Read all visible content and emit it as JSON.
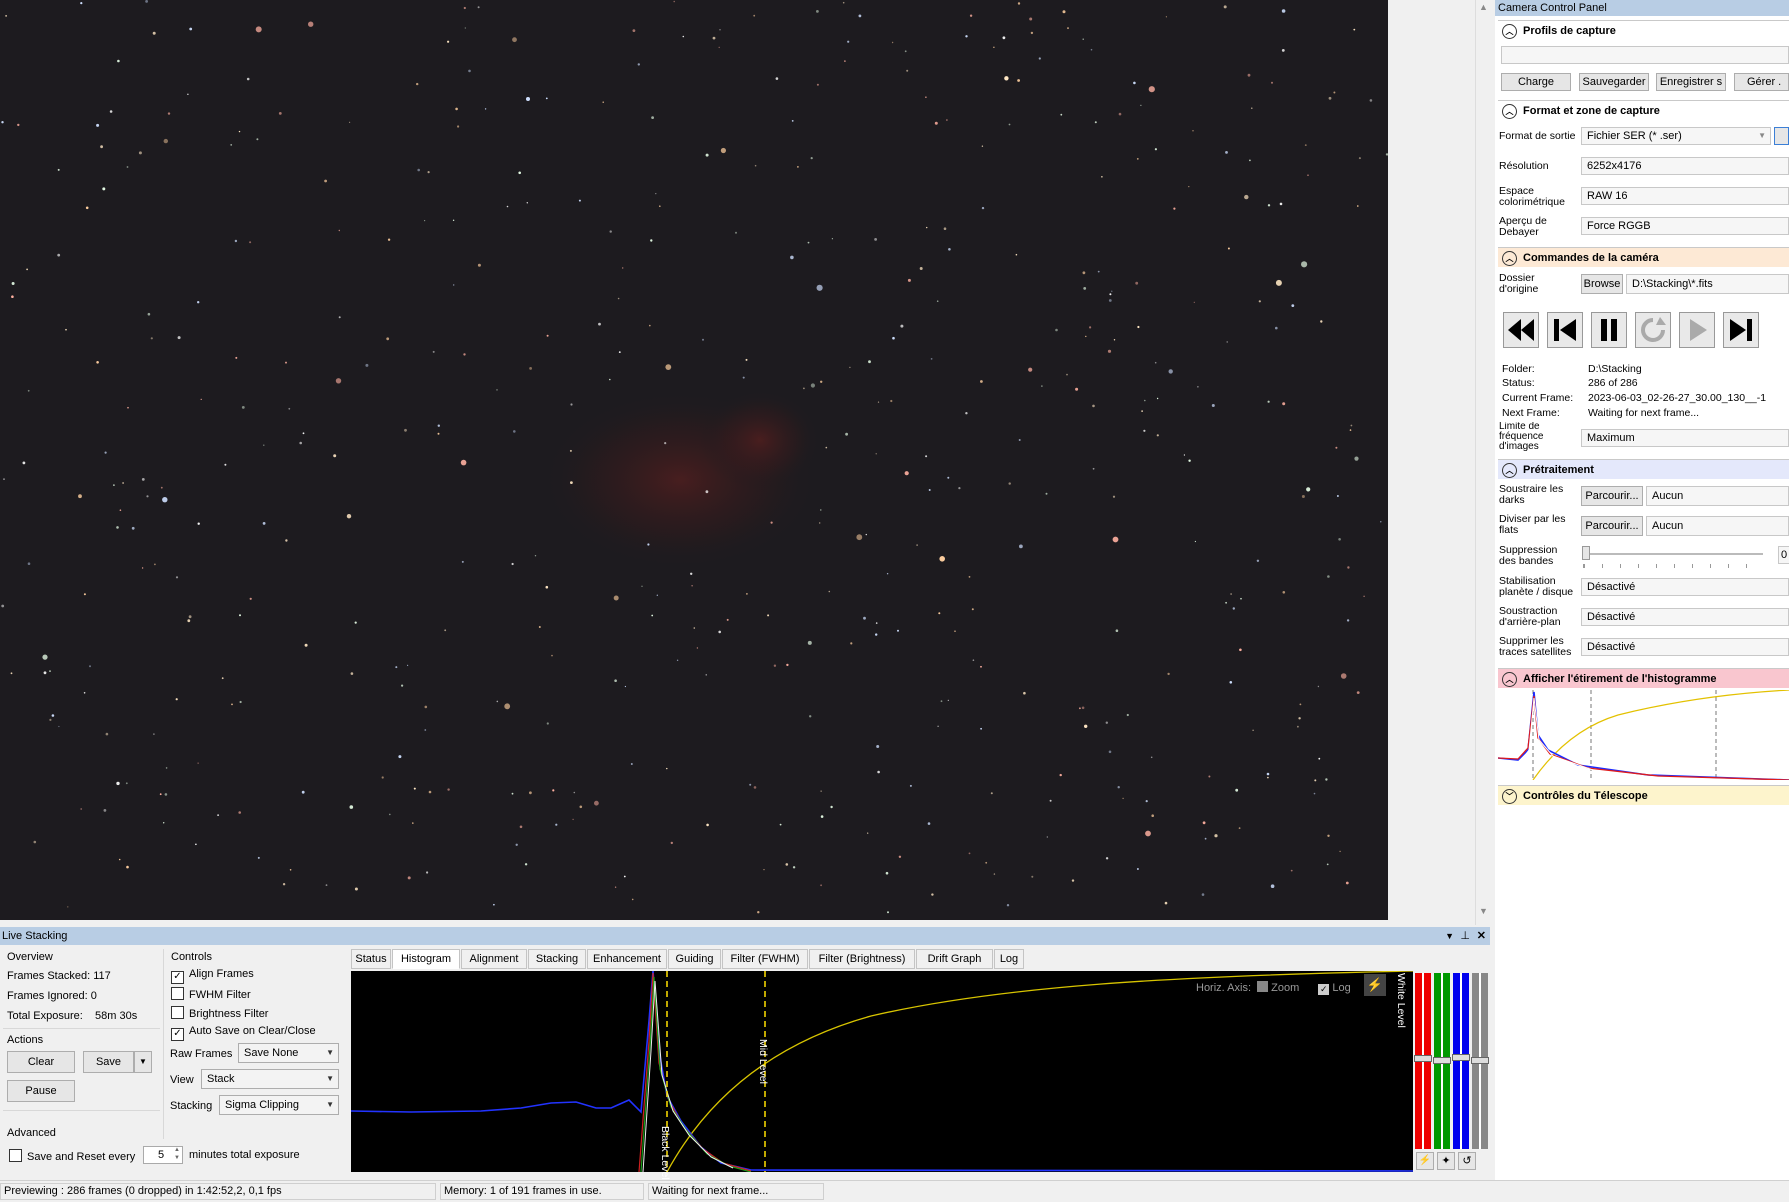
{
  "camera_panel": {
    "title": "Camera Control Panel",
    "profils": {
      "header": "Profils de capture",
      "buttons": [
        "Charge",
        "Sauvegarder",
        "Enregistrer s",
        "Gérer ."
      ]
    },
    "format": {
      "header": "Format et zone de capture",
      "rows": [
        {
          "label": "Format de sortie",
          "value": "Fichier SER (* .ser)"
        },
        {
          "label": "Résolution",
          "value": "6252x4176"
        },
        {
          "label": "Espace colorimétrique",
          "value": "RAW 16"
        },
        {
          "label": "Aperçu de Debayer",
          "value": "Force RGGB"
        }
      ]
    },
    "commandes": {
      "header": "Commandes de la caméra",
      "dossier_label": "Dossier d'origine",
      "browse_label": "Browse",
      "dossier_value": "D:\\Stacking\\*.fits",
      "media_icons": [
        "rewind-icon",
        "skip-back-icon",
        "pause-icon",
        "refresh-icon",
        "play-icon",
        "skip-end-icon"
      ],
      "info": [
        {
          "key": "Folder:",
          "value": "D:\\Stacking"
        },
        {
          "key": "Status:",
          "value": "286 of 286"
        },
        {
          "key": "Current Frame:",
          "value": "2023-06-03_02-26-27_30.00_130__-1"
        },
        {
          "key": "Next Frame:",
          "value": "Waiting for next frame..."
        }
      ],
      "limite_label": "Limite de fréquence d'images",
      "limite_value": "Maximum"
    },
    "pretraitement": {
      "header": "Prétraitement",
      "browse_label": "Parcourir...",
      "darks_label": "Soustraire les darks",
      "darks_value": "Aucun",
      "flats_label": "Diviser par les flats",
      "flats_value": "Aucun",
      "bandes_label": "Suppression des bandes",
      "bandes_value": "0",
      "rows": [
        {
          "label": "Stabilisation planète / disque",
          "value": "Désactivé"
        },
        {
          "label": "Soustraction d'arrière-plan",
          "value": "Désactivé"
        },
        {
          "label": "Supprimer les traces satellites",
          "value": "Désactivé"
        }
      ]
    },
    "histogramme": {
      "header": "Afficher l'étirement de l'histogramme"
    },
    "telescope": {
      "header": "Contrôles du Télescope"
    }
  },
  "live_stacking": {
    "title": "Live Stacking",
    "overview": {
      "header": "Overview",
      "frames_stacked": "Frames Stacked: 117",
      "frames_ignored": "Frames Ignored: 0",
      "total_exposure_label": "Total Exposure:",
      "total_exposure_value": "58m 30s"
    },
    "actions": {
      "header": "Actions",
      "clear": "Clear",
      "save": "Save",
      "pause": "Pause"
    },
    "advanced": {
      "header": "Advanced",
      "save_reset_label": "Save and Reset every",
      "minutes_value": "5",
      "minutes_suffix": "minutes total exposure"
    },
    "controls": {
      "header": "Controls",
      "checkboxes": [
        {
          "label": "Align Frames",
          "checked": true
        },
        {
          "label": "FWHM Filter",
          "checked": false
        },
        {
          "label": "Brightness Filter",
          "checked": false
        },
        {
          "label": "Auto Save on Clear/Close",
          "checked": true
        }
      ],
      "raw_frames_label": "Raw Frames",
      "raw_frames_value": "Save None",
      "view_label": "View",
      "view_value": "Stack",
      "stacking_label": "Stacking",
      "stacking_value": "Sigma Clipping"
    },
    "tabs": [
      "Status",
      "Histogram",
      "Alignment",
      "Stacking",
      "Enhancement",
      "Guiding",
      "Filter (FWHM)",
      "Filter (Brightness)",
      "Drift Graph",
      "Log"
    ],
    "active_tab": "Histogram",
    "histogram": {
      "horiz_axis_label": "Horiz. Axis:",
      "zoom_label": "Zoom",
      "zoom_checked": false,
      "log_label": "Log",
      "log_checked": true,
      "black_level_label": "Black Level",
      "mid_level_label": "Mid Level",
      "white_level_label": "White Level"
    }
  },
  "status_bar": {
    "preview": "Previewing : 286 frames (0 dropped) in 1:42:52,2, 0,1 fps",
    "memory": "Memory: 1 of 191 frames in use.",
    "waiting": "Waiting for next frame..."
  },
  "colors": {
    "panel_title_bg": "#b8cde4",
    "commandes_bg": "#fde9d5",
    "pretraitement_bg": "#e4e8fb",
    "histogramme_bg": "#f9c6cf",
    "telescope_bg": "#fdf4cc",
    "sky_bg": "#1d1b1f"
  }
}
